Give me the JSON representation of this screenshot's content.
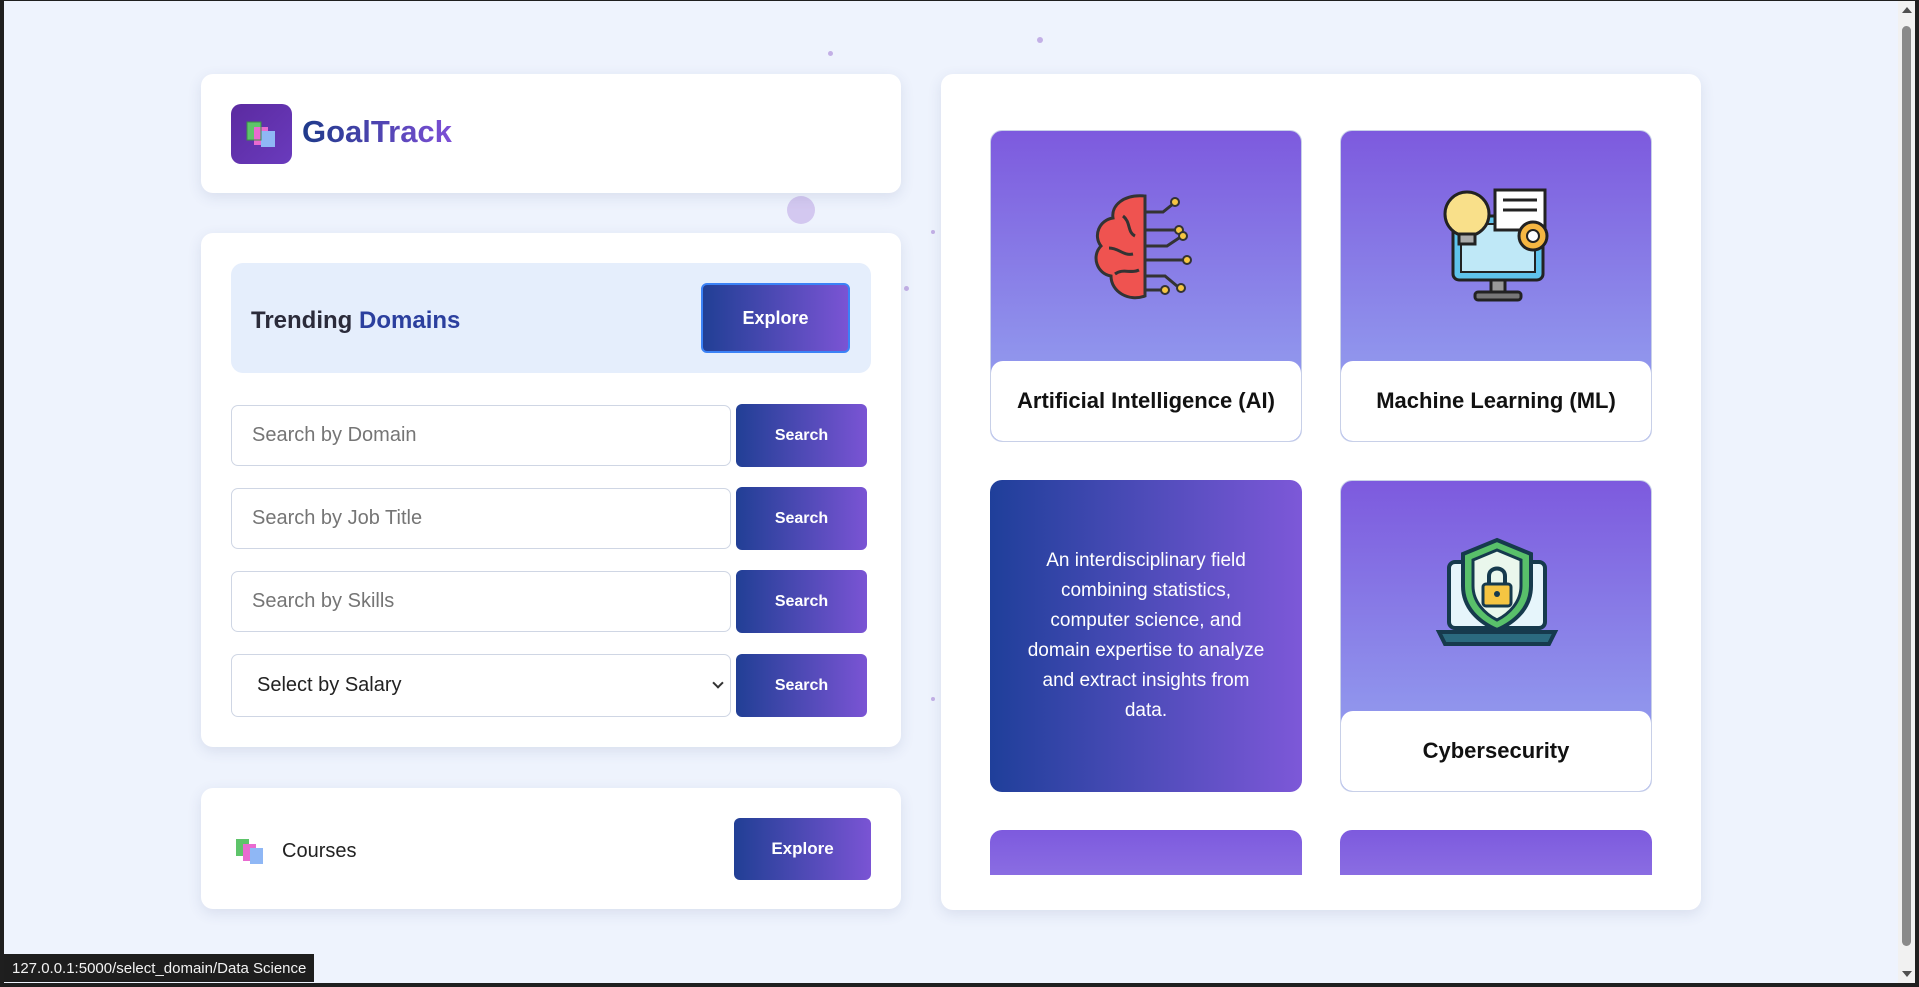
{
  "brand": {
    "name": "GoalTrack",
    "logo_icon": "books-icon"
  },
  "trending": {
    "title_prefix": "Trending",
    "title_accent": "Domains",
    "explore_label": "Explore"
  },
  "search": {
    "domain_placeholder": "Search by Domain",
    "job_placeholder": "Search by Job Title",
    "skills_placeholder": "Search by Skills",
    "salary_selected": "Select by Salary",
    "button_label": "Search"
  },
  "courses": {
    "label": "Courses",
    "icon": "books-icon",
    "explore_label": "Explore"
  },
  "domains": [
    {
      "name": "Artificial Intelligence (AI)",
      "icon": "brain-circuit-icon"
    },
    {
      "name": "Machine Learning (ML)",
      "icon": "lightbulb-gear-monitor-icon"
    },
    {
      "name": "Data Science",
      "description": "An interdisciplinary field combining statistics, computer science, and domain expertise to analyze and extract insights from data."
    },
    {
      "name": "Cybersecurity",
      "icon": "laptop-shield-lock-icon"
    }
  ],
  "status_bar": {
    "url": "127.0.0.1:5000/select_domain/Data Science"
  },
  "colors": {
    "accent_start": "#213f95",
    "accent_end": "#7a54d4",
    "background": "#eef3fd",
    "tile_gradient_top": "#7d5ade"
  }
}
